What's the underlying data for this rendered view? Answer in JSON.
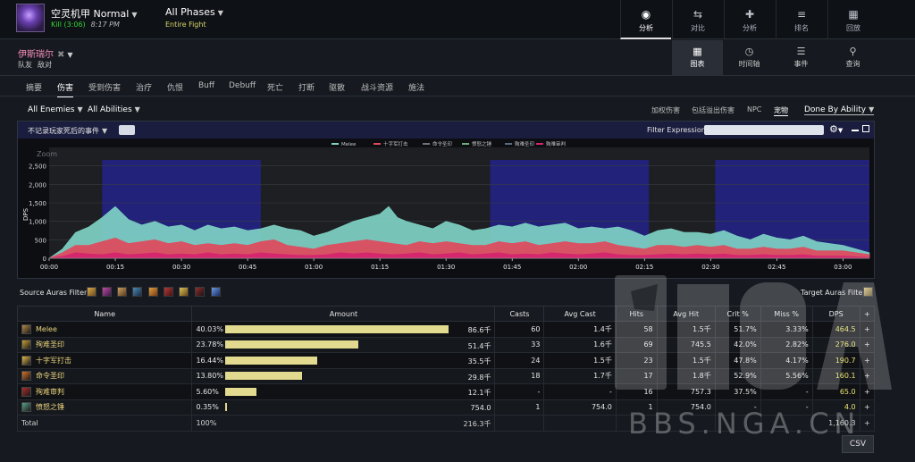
{
  "header": {
    "boss_name": "空灵机甲",
    "difficulty": "Normal",
    "kill_label": "Kill (3:06)",
    "kill_time": "8:17 PM",
    "phase_label": "All Phases",
    "phase_sub": "Entire Fight",
    "nav_tabs": [
      {
        "label": "分析",
        "icon": "eye-icon"
      },
      {
        "label": "对比",
        "icon": "compare-icon"
      },
      {
        "label": "分析",
        "icon": "puzzle-icon"
      },
      {
        "label": "排名",
        "icon": "rank-icon"
      },
      {
        "label": "回放",
        "icon": "replay-icon"
      }
    ]
  },
  "player": {
    "name": "伊斯瑞尔",
    "tag_friend": "队友",
    "tag_enemy": "敌对",
    "views": [
      {
        "label": "图表",
        "icon": "grid-icon"
      },
      {
        "label": "时间轴",
        "icon": "clock-icon"
      },
      {
        "label": "事件",
        "icon": "list-icon"
      },
      {
        "label": "查询",
        "icon": "pin-icon"
      }
    ]
  },
  "subtabs": [
    "摘要",
    "伤害",
    "受到伤害",
    "治疗",
    "仇恨",
    "Buff",
    "Debuff",
    "死亡",
    "打断",
    "驱散",
    "战斗资源",
    "施法"
  ],
  "filters": {
    "enemies": "All Enemies",
    "abilities": "All Abilities",
    "options": [
      "加权伤害",
      "包括溢出伤害",
      "NPC",
      "宠物"
    ],
    "done_by": "Done By Ability"
  },
  "chart_header": {
    "death_toggle": "不记录玩家死后的事件",
    "filter_label": "Filter Expression:"
  },
  "chart_data": {
    "type": "area",
    "title": "",
    "xlabel": "",
    "ylabel": "DPS",
    "zoom_label": "Zoom",
    "ylim": [
      0,
      3000
    ],
    "yticks": [
      "0",
      "500",
      "1,000",
      "1,500",
      "2,000",
      "2,500"
    ],
    "ytick_values": [
      0,
      500,
      1000,
      1500,
      2000,
      2500
    ],
    "xlim": [
      0,
      186
    ],
    "xticks": [
      "00:00",
      "00:15",
      "00:30",
      "00:45",
      "01:00",
      "01:15",
      "01:30",
      "01:45",
      "02:00",
      "02:15",
      "02:30",
      "02:45",
      "03:00"
    ],
    "xtick_values": [
      0,
      15,
      30,
      45,
      60,
      75,
      90,
      105,
      120,
      135,
      150,
      165,
      180
    ],
    "phase_bands": [
      [
        12,
        48
      ],
      [
        100,
        136
      ],
      [
        151,
        187
      ]
    ],
    "legend": [
      "Melee",
      "十字军打击",
      "命令圣印",
      "愤怒之锤",
      "殉难圣印",
      "殉难审判"
    ],
    "series": [
      {
        "name": "Melee",
        "color": "#7fd1c4",
        "values": [
          [
            0,
            0
          ],
          [
            3,
            250
          ],
          [
            6,
            700
          ],
          [
            9,
            850
          ],
          [
            12,
            1100
          ],
          [
            15,
            1400
          ],
          [
            18,
            1050
          ],
          [
            21,
            900
          ],
          [
            24,
            1000
          ],
          [
            27,
            850
          ],
          [
            30,
            900
          ],
          [
            33,
            750
          ],
          [
            36,
            900
          ],
          [
            39,
            800
          ],
          [
            42,
            850
          ],
          [
            45,
            750
          ],
          [
            48,
            800
          ],
          [
            51,
            900
          ],
          [
            54,
            800
          ],
          [
            57,
            750
          ],
          [
            60,
            600
          ],
          [
            63,
            700
          ],
          [
            66,
            850
          ],
          [
            69,
            1000
          ],
          [
            72,
            1100
          ],
          [
            75,
            1200
          ],
          [
            77,
            1400
          ],
          [
            79,
            1100
          ],
          [
            81,
            1000
          ],
          [
            84,
            900
          ],
          [
            87,
            800
          ],
          [
            90,
            1000
          ],
          [
            93,
            900
          ],
          [
            96,
            750
          ],
          [
            99,
            800
          ],
          [
            102,
            900
          ],
          [
            105,
            850
          ],
          [
            108,
            950
          ],
          [
            111,
            850
          ],
          [
            114,
            900
          ],
          [
            117,
            950
          ],
          [
            120,
            800
          ],
          [
            123,
            850
          ],
          [
            126,
            800
          ],
          [
            129,
            850
          ],
          [
            132,
            750
          ],
          [
            135,
            600
          ],
          [
            138,
            750
          ],
          [
            141,
            800
          ],
          [
            144,
            700
          ],
          [
            147,
            700
          ],
          [
            150,
            650
          ],
          [
            153,
            750
          ],
          [
            156,
            600
          ],
          [
            159,
            500
          ],
          [
            162,
            650
          ],
          [
            165,
            550
          ],
          [
            168,
            500
          ],
          [
            171,
            600
          ],
          [
            174,
            450
          ],
          [
            177,
            400
          ],
          [
            180,
            350
          ],
          [
            183,
            250
          ],
          [
            186,
            150
          ]
        ]
      },
      {
        "name": "十字军打击",
        "color": "#e04a5c",
        "values": [
          [
            0,
            0
          ],
          [
            3,
            150
          ],
          [
            6,
            350
          ],
          [
            9,
            350
          ],
          [
            12,
            450
          ],
          [
            15,
            550
          ],
          [
            18,
            400
          ],
          [
            21,
            450
          ],
          [
            24,
            500
          ],
          [
            27,
            400
          ],
          [
            30,
            450
          ],
          [
            33,
            350
          ],
          [
            36,
            400
          ],
          [
            39,
            350
          ],
          [
            42,
            400
          ],
          [
            45,
            350
          ],
          [
            48,
            450
          ],
          [
            51,
            500
          ],
          [
            54,
            350
          ],
          [
            57,
            300
          ],
          [
            60,
            250
          ],
          [
            63,
            350
          ],
          [
            66,
            400
          ],
          [
            69,
            450
          ],
          [
            72,
            500
          ],
          [
            75,
            450
          ],
          [
            78,
            400
          ],
          [
            81,
            350
          ],
          [
            84,
            450
          ],
          [
            87,
            400
          ],
          [
            90,
            450
          ],
          [
            93,
            400
          ],
          [
            96,
            350
          ],
          [
            99,
            350
          ],
          [
            102,
            450
          ],
          [
            105,
            400
          ],
          [
            108,
            450
          ],
          [
            111,
            350
          ],
          [
            114,
            400
          ],
          [
            117,
            450
          ],
          [
            120,
            400
          ],
          [
            123,
            400
          ],
          [
            126,
            450
          ],
          [
            129,
            350
          ],
          [
            132,
            300
          ],
          [
            135,
            250
          ],
          [
            138,
            350
          ],
          [
            141,
            350
          ],
          [
            144,
            300
          ],
          [
            147,
            350
          ],
          [
            150,
            300
          ],
          [
            153,
            350
          ],
          [
            156,
            250
          ],
          [
            159,
            250
          ],
          [
            162,
            300
          ],
          [
            165,
            250
          ],
          [
            168,
            250
          ],
          [
            171,
            300
          ],
          [
            174,
            200
          ],
          [
            177,
            200
          ],
          [
            180,
            200
          ],
          [
            183,
            150
          ],
          [
            186,
            100
          ]
        ]
      },
      {
        "name": "殉难审判",
        "color": "#d6246e",
        "values": [
          [
            0,
            0
          ],
          [
            3,
            50
          ],
          [
            6,
            150
          ],
          [
            9,
            120
          ],
          [
            12,
            100
          ],
          [
            15,
            150
          ],
          [
            18,
            100
          ],
          [
            21,
            120
          ],
          [
            24,
            150
          ],
          [
            27,
            100
          ],
          [
            30,
            120
          ],
          [
            33,
            100
          ],
          [
            36,
            150
          ],
          [
            39,
            100
          ],
          [
            42,
            120
          ],
          [
            45,
            100
          ],
          [
            48,
            150
          ],
          [
            51,
            120
          ],
          [
            54,
            100
          ],
          [
            57,
            80
          ],
          [
            60,
            80
          ],
          [
            63,
            100
          ],
          [
            66,
            150
          ],
          [
            69,
            120
          ],
          [
            72,
            150
          ],
          [
            75,
            120
          ],
          [
            78,
            100
          ],
          [
            81,
            120
          ],
          [
            84,
            150
          ],
          [
            87,
            100
          ],
          [
            90,
            120
          ],
          [
            93,
            150
          ],
          [
            96,
            100
          ],
          [
            99,
            120
          ],
          [
            102,
            150
          ],
          [
            105,
            100
          ],
          [
            108,
            120
          ],
          [
            111,
            100
          ],
          [
            114,
            150
          ],
          [
            117,
            120
          ],
          [
            120,
            100
          ],
          [
            123,
            120
          ],
          [
            126,
            150
          ],
          [
            129,
            100
          ],
          [
            132,
            80
          ],
          [
            135,
            80
          ],
          [
            138,
            100
          ],
          [
            141,
            120
          ],
          [
            144,
            100
          ],
          [
            147,
            120
          ],
          [
            150,
            100
          ],
          [
            153,
            120
          ],
          [
            156,
            80
          ],
          [
            159,
            80
          ],
          [
            162,
            100
          ],
          [
            165,
            80
          ],
          [
            168,
            80
          ],
          [
            171,
            100
          ],
          [
            174,
            60
          ],
          [
            177,
            60
          ],
          [
            180,
            60
          ],
          [
            183,
            40
          ],
          [
            186,
            20
          ]
        ]
      }
    ]
  },
  "auras": {
    "source_label": "Source Auras Filter:",
    "target_label": "Target Auras Filter:",
    "source_icons": [
      "aura-icon-1",
      "aura-icon-2",
      "aura-icon-3",
      "aura-icon-4",
      "aura-icon-5",
      "aura-icon-6",
      "aura-icon-7",
      "aura-icon-8",
      "aura-icon-9"
    ]
  },
  "table": {
    "columns": [
      "Name",
      "Amount",
      "Casts",
      "Avg Cast",
      "Hits",
      "Avg Hit",
      "Crit %",
      "Miss %",
      "DPS",
      "+"
    ],
    "rows": [
      {
        "name": "Melee",
        "icon": "melee-icon",
        "icon_color": "#b48a4a",
        "pct": "40.03%",
        "share": 0.4003,
        "amount": "86.6千",
        "casts": "60",
        "avg_cast": "1.4千",
        "hits": "58",
        "avg_hit": "1.5千",
        "crit": "51.7%",
        "miss": "3.33%",
        "dps": "464.5"
      },
      {
        "name": "殉难圣印",
        "icon": "seal-martyr-icon",
        "icon_color": "#c9a236",
        "pct": "23.78%",
        "share": 0.2378,
        "amount": "51.4千",
        "casts": "33",
        "avg_cast": "1.6千",
        "hits": "69",
        "avg_hit": "745.5",
        "crit": "42.0%",
        "miss": "2.82%",
        "dps": "276.0"
      },
      {
        "name": "十字军打击",
        "icon": "crusader-strike-icon",
        "icon_color": "#e0b84a",
        "pct": "16.44%",
        "share": 0.1644,
        "amount": "35.5千",
        "casts": "24",
        "avg_cast": "1.5千",
        "hits": "23",
        "avg_hit": "1.5千",
        "crit": "47.8%",
        "miss": "4.17%",
        "dps": "190.7"
      },
      {
        "name": "命令圣印",
        "icon": "seal-command-icon",
        "icon_color": "#d9732a",
        "pct": "13.80%",
        "share": 0.138,
        "amount": "29.8千",
        "casts": "18",
        "avg_cast": "1.7千",
        "hits": "17",
        "avg_hit": "1.8千",
        "crit": "52.9%",
        "miss": "5.56%",
        "dps": "160.1"
      },
      {
        "name": "殉难审判",
        "icon": "judgement-icon",
        "icon_color": "#b02a2a",
        "pct": "5.60%",
        "share": 0.056,
        "amount": "12.1千",
        "casts": "-",
        "avg_cast": "-",
        "hits": "16",
        "avg_hit": "757.3",
        "crit": "37.5%",
        "miss": "-",
        "dps": "65.0"
      },
      {
        "name": "愤怒之锤",
        "icon": "hammer-wrath-icon",
        "icon_color": "#5aa08a",
        "pct": "0.35%",
        "share": 0.0035,
        "amount": "754.0",
        "casts": "1",
        "avg_cast": "754.0",
        "hits": "1",
        "avg_hit": "754.0",
        "crit": "-",
        "miss": "-",
        "dps": "4.0"
      }
    ],
    "total": {
      "label": "Total",
      "pct": "100%",
      "amount": "216.3千",
      "dps": "1,160.3"
    },
    "plus": "+"
  },
  "watermark_text": "BBS.NGA.CN",
  "csv_label": "CSV"
}
